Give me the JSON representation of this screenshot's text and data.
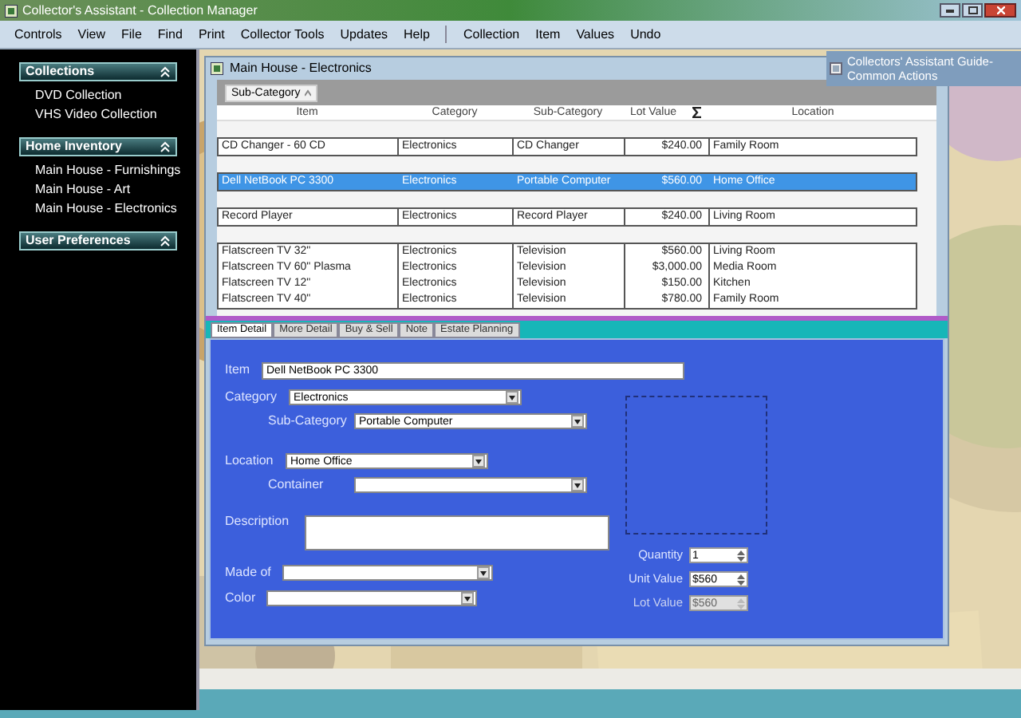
{
  "window": {
    "title": "Collector's Assistant - Collection Manager"
  },
  "menu": [
    {
      "label": "Controls"
    },
    {
      "label": "View"
    },
    {
      "label": "File"
    },
    {
      "label": "Find"
    },
    {
      "label": "Print"
    },
    {
      "label": "Collector Tools"
    },
    {
      "label": "Updates"
    },
    {
      "label": "Help",
      "separator_after": true
    },
    {
      "label": "Collection"
    },
    {
      "label": "Item"
    },
    {
      "label": "Values"
    },
    {
      "label": "Undo"
    }
  ],
  "sidebar": {
    "sections": [
      {
        "title": "Collections",
        "items": [
          "DVD Collection",
          "VHS Video Collection"
        ]
      },
      {
        "title": "Home Inventory",
        "items": [
          "Main House - Furnishings",
          "Main House - Art",
          "Main House - Electronics"
        ]
      },
      {
        "title": "User Preferences"
      }
    ]
  },
  "guide": {
    "title": "Collectors' Assistant Guide-Common Actions"
  },
  "document": {
    "title": "Main House - Electronics",
    "group_by": "Sub-Category",
    "columns": [
      "Item",
      "Category",
      "Sub-Category",
      "Lot Value",
      "Location"
    ],
    "groups": [
      {
        "rows": [
          {
            "cells": [
              "CD Changer - 60 CD",
              "Electronics",
              "CD Changer",
              "$240.00",
              "Family Room"
            ],
            "selected": false
          }
        ]
      },
      {
        "rows": [
          {
            "cells": [
              "Dell NetBook PC 3300",
              "Electronics",
              "Portable Computer",
              "$560.00",
              "Home Office"
            ],
            "selected": true
          }
        ]
      },
      {
        "rows": [
          {
            "cells": [
              "Record Player",
              "Electronics",
              "Record Player",
              "$240.00",
              "Living Room"
            ],
            "selected": false
          }
        ]
      },
      {
        "rows": [
          {
            "cells": [
              "Flatscreen TV 32\"",
              "Electronics",
              "Television",
              "$560.00",
              "Living Room"
            ],
            "selected": false
          },
          {
            "cells": [
              "Flatscreen TV 60\" Plasma",
              "Electronics",
              "Television",
              "$3,000.00",
              "Media Room"
            ],
            "selected": false
          },
          {
            "cells": [
              "Flatscreen TV 12\"",
              "Electronics",
              "Television",
              "$150.00",
              "Kitchen"
            ],
            "selected": false
          },
          {
            "cells": [
              "Flatscreen TV 40\"",
              "Electronics",
              "Television",
              "$780.00",
              "Family Room"
            ],
            "selected": false
          }
        ]
      }
    ]
  },
  "tabs": [
    {
      "label": "Item Detail",
      "selected": true
    },
    {
      "label": "More Detail",
      "selected": false
    },
    {
      "label": "Buy & Sell",
      "selected": false
    },
    {
      "label": "Note",
      "selected": false
    },
    {
      "label": "Estate Planning",
      "selected": false
    }
  ],
  "form": {
    "item": {
      "label": "Item",
      "value": "Dell NetBook PC 3300"
    },
    "fields": [
      {
        "label": "Category",
        "kind": "dropdown",
        "value": "Electronics",
        "children": [
          {
            "label": "Sub-Category",
            "kind": "dropdown",
            "value": "Portable Computer"
          }
        ]
      },
      {
        "label": "Location",
        "kind": "dropdown",
        "value": "Home Office",
        "children": [
          {
            "label": "Container",
            "kind": "dropdown"
          }
        ]
      },
      {
        "label": "Description",
        "kind": "textarea"
      },
      {
        "label": "Made of",
        "kind": "dropdown"
      },
      {
        "label": "Color",
        "kind": "dropdown"
      }
    ],
    "values": [
      {
        "label": "Quantity",
        "value": "1",
        "disabled": false
      },
      {
        "label": "Unit Value",
        "value": "$560",
        "disabled": false
      },
      {
        "label": "Lot Value",
        "value": "$560",
        "disabled": true
      }
    ]
  }
}
